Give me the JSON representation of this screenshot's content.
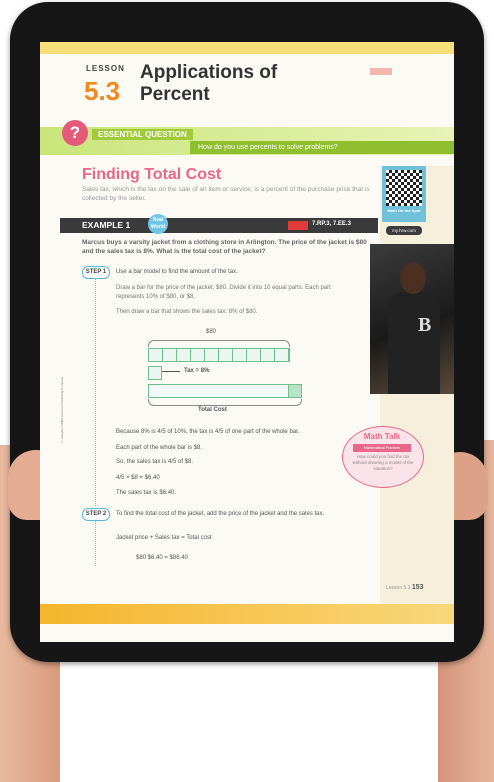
{
  "lesson": {
    "word": "LESSON",
    "number": "5.3",
    "title": "Applications of Percent"
  },
  "essential_question": {
    "label": "ESSENTIAL QUESTION",
    "icon": "?",
    "question": "How do you use percents to solve problems?"
  },
  "section": {
    "title": "Finding Total Cost",
    "subtitle": "Sales tax, which is the tax on the sale of an item or service, is a percent of the purchase price that is collected by the seller."
  },
  "example": {
    "label": "EXAMPLE 1",
    "badge": "Real World",
    "standards": "7.RP.3, 7.EE.3",
    "problem": "Marcus buys a varsity jacket from a clothing store in Arlington. The price of the jacket is $80 and the sales tax is 8%. What is the total cost of the jacket?"
  },
  "step1": {
    "label": "STEP 1",
    "intro": "Use a bar model to find the amount of the tax.",
    "p1": "Draw a bar for the price of the jacket, $80. Divide it into 10 equal parts. Each part represents 10% of $80, or $8.",
    "p2": "Then draw a bar that shows the sales tax: 8% of $80.",
    "bar_top_label": "$80",
    "tax_label": "Tax = 8%",
    "total_label": "Total Cost",
    "l1": "Because 8% is 4/5 of 10%, the tax is 4/5 of one part of the whole bar.",
    "l2": "Each part of the whole bar is $8.",
    "l3": "So, the sales tax is 4/5 of $8.",
    "l4": "4/5 × $8 = $6.40",
    "l5": "The sales tax is $6.40."
  },
  "step2": {
    "label": "STEP 2",
    "intro": "To find the total cost of the jacket, add the price of the jacket and the sales tax.",
    "eq_words": "Jacket price + Sales tax = Total cost",
    "eq_values": "$80 $6.40 = $86.40"
  },
  "sidebar": {
    "qr_label": "Math On the Spot",
    "link": "my.hrw.com",
    "math_talk_title": "Math Talk",
    "math_talk_sub": "Mathematical Practices",
    "math_talk_q": "How could you find the tax without drawing a model of the situation?"
  },
  "footer": {
    "lesson_ref": "Lesson 5.3",
    "page": "153"
  },
  "copyright": "©Houghton Mifflin Harcourt Publishing Company"
}
